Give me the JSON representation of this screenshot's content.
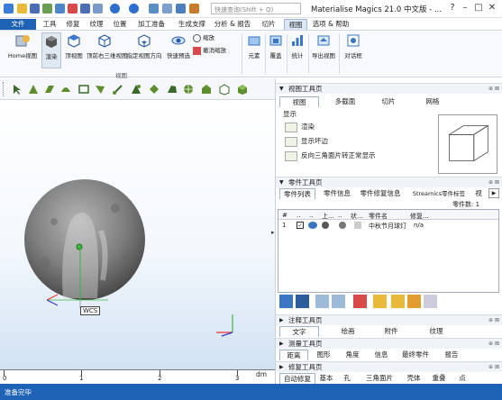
{
  "window": {
    "title": "Materialise Magics 21.0 中文版 - ...",
    "search_placeholder": "快速查询(Shift + Q)"
  },
  "menu": {
    "tabs": [
      "文件",
      "工具",
      "修复",
      "纹理",
      "位置",
      "加工准备",
      "生成支撑",
      "分析 & 报告",
      "切片",
      "视图",
      "选项 & 帮助"
    ],
    "active": "视图"
  },
  "ribbon": {
    "buttons": [
      "Home视图",
      "渲染",
      "顶视图",
      "顶前右三维视图",
      "指定视图方向",
      "快速预选"
    ],
    "small_buttons": [
      "缩放",
      "撤消缩放"
    ],
    "right_buttons": [
      "元素",
      "覆盖",
      "统计",
      "导出视图",
      "对话框"
    ],
    "group_label": "视图"
  },
  "viewport": {
    "wcs_label": "WCS"
  },
  "ruler": {
    "ticks": [
      "0",
      "1",
      "2",
      "3"
    ],
    "unit": "dm"
  },
  "view_panel": {
    "title": "视图工具页",
    "tabs": [
      "视图",
      "多截面",
      "切片",
      "网格"
    ],
    "section": "显示",
    "options": [
      "渲染",
      "显示坏边",
      "反向三角面片转正常显示"
    ]
  },
  "part_panel": {
    "title": "零件工具页",
    "tabs": [
      "零件列表",
      "零件信息",
      "零件修复信息",
      "Streamics零件标签",
      "视"
    ],
    "parts_count": "零件数: 1",
    "columns": [
      "#",
      "..",
      "..",
      "上...",
      "..",
      "状...",
      "零件名",
      "修复..."
    ],
    "rows": [
      {
        "num": "1",
        "name": "中秋节月球灯",
        "repair": "n/a"
      }
    ]
  },
  "annotation_panel": {
    "title": "注释工具页",
    "tabs": [
      "文字",
      "绘画",
      "附件",
      "纹理"
    ]
  },
  "measure_panel": {
    "title": "测量工具页",
    "tabs": [
      "距离",
      "图形",
      "角度",
      "信息",
      "最终零件",
      "报告"
    ]
  },
  "repair_panel": {
    "title": "修复工具页",
    "tabs": [
      "自动修复",
      "基本",
      "孔",
      "三角面片",
      "壳体",
      "重叠",
      "点"
    ]
  },
  "status": {
    "text": "准备完毕"
  }
}
